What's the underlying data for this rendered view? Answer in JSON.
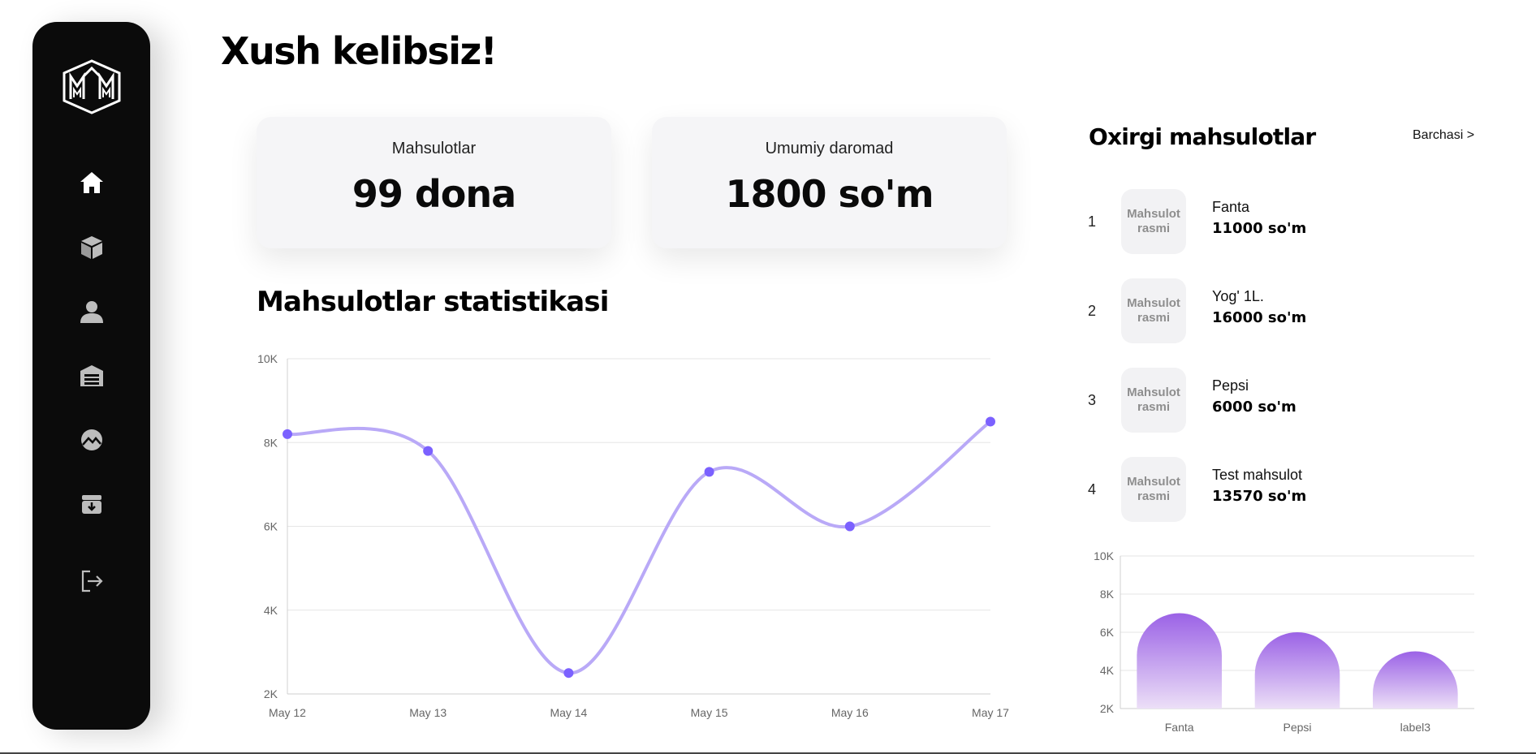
{
  "header": {
    "title": "Xush kelibsiz!"
  },
  "sidebar": {
    "items": [
      {
        "icon": "home-icon",
        "active": true
      },
      {
        "icon": "box-icon",
        "active": false
      },
      {
        "icon": "user-icon",
        "active": false
      },
      {
        "icon": "warehouse-icon",
        "active": false
      },
      {
        "icon": "chart-circle-icon",
        "active": false
      },
      {
        "icon": "archive-icon",
        "active": false
      },
      {
        "icon": "logout-icon",
        "active": false
      }
    ]
  },
  "cards": [
    {
      "label": "Mahsulotlar",
      "value": "99 dona"
    },
    {
      "label": "Umumiy daromad",
      "value": "1800 so'm"
    }
  ],
  "stats": {
    "title": "Mahsulotlar statistikasi"
  },
  "recent": {
    "title": "Oxirgi mahsulotlar",
    "see_all": "Barchasi >",
    "items": [
      {
        "index": "1",
        "thumb": "Mahsulot rasmi",
        "name": "Fanta",
        "price": "11000 so'm"
      },
      {
        "index": "2",
        "thumb": "Mahsulot rasmi",
        "name": "Yog' 1L.",
        "price": "16000 so'm"
      },
      {
        "index": "3",
        "thumb": "Mahsulot rasmi",
        "name": "Pepsi",
        "price": "6000 so'm"
      },
      {
        "index": "4",
        "thumb": "Mahsulot rasmi",
        "name": "Test mahsulot",
        "price": "13570 so'm"
      }
    ]
  },
  "colors": {
    "accent": "#7b61ff",
    "line": "#b9a9f7",
    "sidebar": "#0b0b0b",
    "card": "#f5f5f7"
  },
  "chart_data": [
    {
      "type": "line",
      "categories": [
        "May 12",
        "May 13",
        "May 14",
        "May 15",
        "May 16",
        "May 17"
      ],
      "values": [
        8200,
        7800,
        2500,
        7300,
        6000,
        8500
      ],
      "ylim": [
        2000,
        10000
      ],
      "yticks": [
        "2K",
        "4K",
        "6K",
        "8K",
        "10K"
      ],
      "grid": true
    },
    {
      "type": "bar",
      "categories": [
        "Fanta",
        "Pepsi",
        "label3"
      ],
      "values": [
        7000,
        6000,
        5000
      ],
      "ylim": [
        2000,
        10000
      ],
      "yticks": [
        "2K",
        "4K",
        "6K",
        "8K",
        "10K"
      ],
      "grid": true
    }
  ]
}
